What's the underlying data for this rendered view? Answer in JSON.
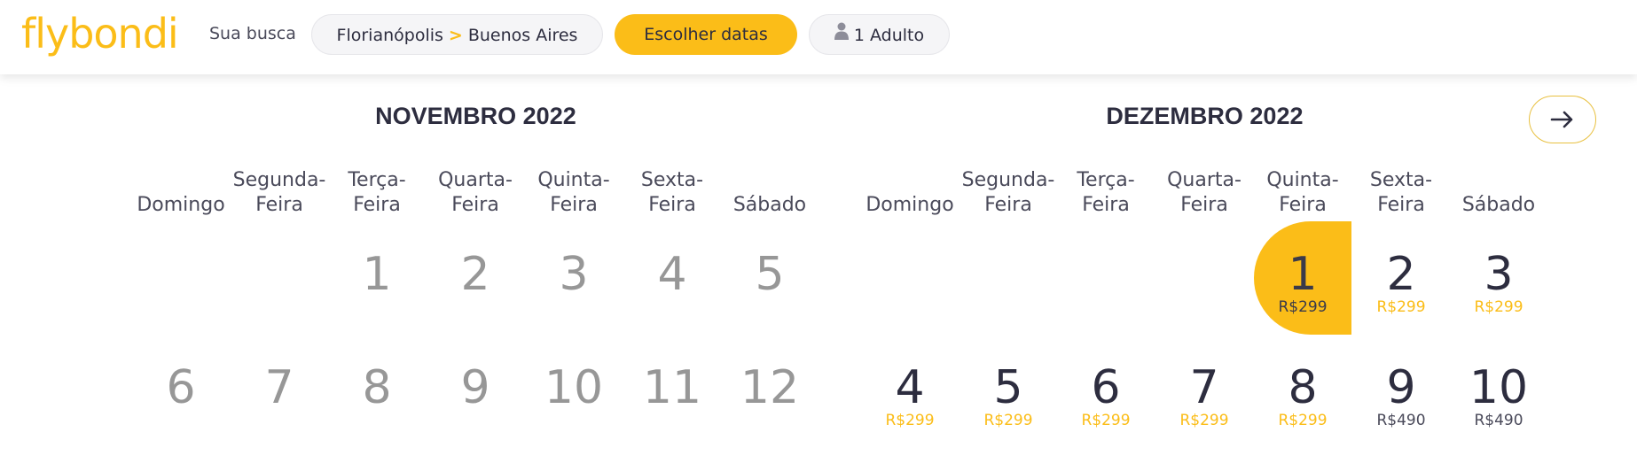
{
  "header": {
    "logo": "flybondi",
    "search_label": "Sua busca",
    "route_origin": "Florianópolis",
    "route_separator": ">",
    "route_destination": "Buenos Aires",
    "dates_button": "Escolher datas",
    "passengers": "1 Adulto"
  },
  "colors": {
    "brand_yellow": "#fbbd18",
    "text_dark": "#2d2d3f",
    "text_muted": "#979797"
  },
  "calendar": {
    "weekdays": [
      [
        "",
        "Domingo"
      ],
      [
        "Segunda-",
        "Feira"
      ],
      [
        "Terça-",
        "Feira"
      ],
      [
        "Quarta-",
        "Feira"
      ],
      [
        "Quinta-",
        "Feira"
      ],
      [
        "Sexta-",
        "Feira"
      ],
      [
        "",
        "Sábado"
      ]
    ],
    "next_icon": "arrow-right-icon",
    "months": [
      {
        "title": "NOVEMBRO 2022",
        "weeks": [
          [
            null,
            null,
            {
              "day": "1",
              "past": true
            },
            {
              "day": "2",
              "past": true
            },
            {
              "day": "3",
              "past": true
            },
            {
              "day": "4",
              "past": true
            },
            {
              "day": "5",
              "past": true
            }
          ],
          [
            {
              "day": "6",
              "past": true
            },
            {
              "day": "7",
              "past": true
            },
            {
              "day": "8",
              "past": true
            },
            {
              "day": "9",
              "past": true
            },
            {
              "day": "10",
              "past": true
            },
            {
              "day": "11",
              "past": true
            },
            {
              "day": "12",
              "past": true
            }
          ]
        ]
      },
      {
        "title": "DEZEMBRO 2022",
        "weeks": [
          [
            null,
            null,
            null,
            null,
            {
              "day": "1",
              "price": "R$299",
              "selected": true
            },
            {
              "day": "2",
              "price": "R$299"
            },
            {
              "day": "3",
              "price": "R$299"
            }
          ],
          [
            {
              "day": "4",
              "price": "R$299"
            },
            {
              "day": "5",
              "price": "R$299"
            },
            {
              "day": "6",
              "price": "R$299"
            },
            {
              "day": "7",
              "price": "R$299"
            },
            {
              "day": "8",
              "price": "R$299"
            },
            {
              "day": "9",
              "price": "R$490",
              "high": true
            },
            {
              "day": "10",
              "price": "R$490",
              "high": true
            }
          ]
        ]
      }
    ]
  }
}
